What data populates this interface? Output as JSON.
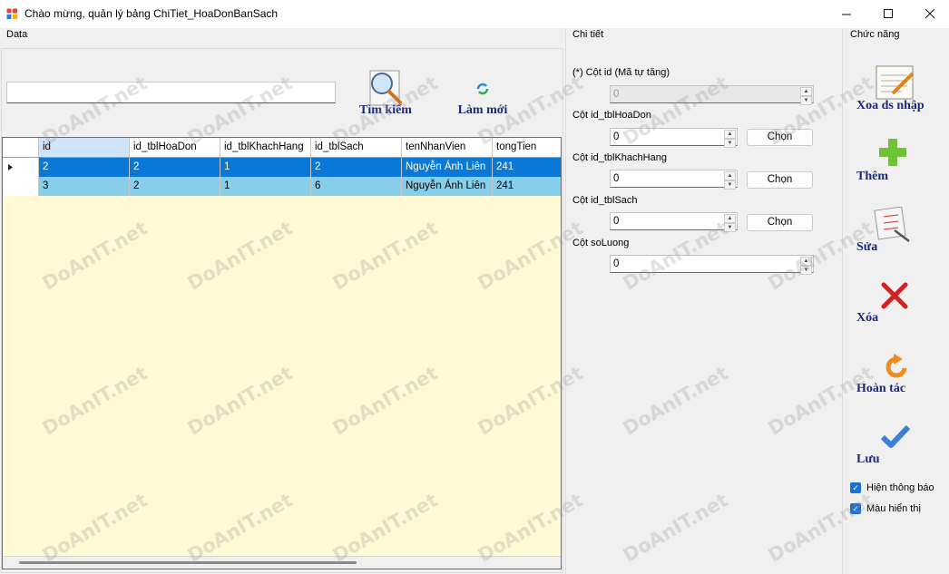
{
  "window": {
    "title": "Chào mừng, quản lý bảng ChiTiet_HoaDonBanSach",
    "controls": [
      "minimize-icon",
      "maximize-icon",
      "close-icon"
    ]
  },
  "groups": {
    "data": "Data",
    "detail": "Chi tiết",
    "functions": "Chức năng"
  },
  "search": {
    "value": "",
    "search_label": "Tìm kiếm",
    "refresh_label": "Làm mới"
  },
  "grid": {
    "columns": [
      "id",
      "id_tblHoaDon",
      "id_tblKhachHang",
      "id_tblSach",
      "tenNhanVien",
      "tongTien"
    ],
    "rows": [
      [
        "2",
        "2",
        "1",
        "2",
        "Nguyễn Ánh Liên",
        "241"
      ],
      [
        "3",
        "2",
        "1",
        "6",
        "Nguyễn Ánh Liên",
        "241"
      ]
    ],
    "selected_row": 0
  },
  "detail": {
    "id_label": "(*) Cột id (Mã tự tăng)",
    "id_value": "0",
    "hoadon_label": "Cột id_tblHoaDon",
    "hoadon_value": "0",
    "khachhang_label": "Cột id_tblKhachHang",
    "khachhang_value": "0",
    "sach_label": "Cột id_tblSach",
    "sach_value": "0",
    "soluong_label": "Cột soLuong",
    "soluong_value": "0",
    "choose_label": "Chọn"
  },
  "functions": {
    "clear_draft": "Xoa ds nhập",
    "add": "Thêm",
    "edit": "Sửa",
    "delete": "Xóa",
    "undo": "Hoàn tác",
    "save": "Lưu",
    "show_notify": "Hiện thông báo",
    "show_color": "Màu hiển thị"
  },
  "watermark": "DoAnIT.net",
  "colors": {
    "selected_row": "#0a78d7",
    "alt_row": "#87ceeb",
    "grid_bg": "#fff9d6",
    "button_text": "#1a2a7a"
  }
}
